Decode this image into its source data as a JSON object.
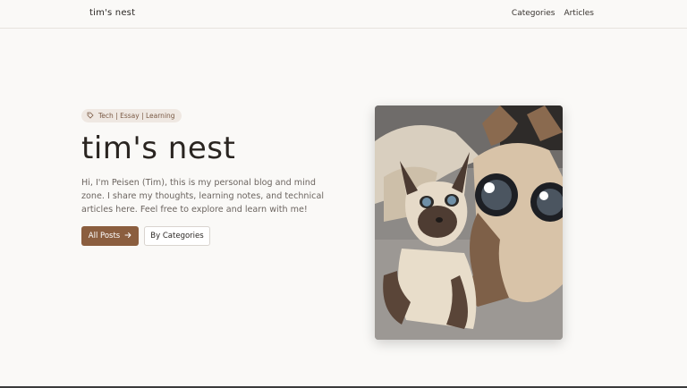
{
  "header": {
    "site_title": "tim's nest",
    "nav": [
      "Categories",
      "Articles"
    ]
  },
  "hero": {
    "tag_icon": "tag-icon",
    "tags_text": "Tech | Essay | Learning",
    "title": "tim's nest",
    "description": "Hi, I'm Peisen (Tim), this is my personal blog and mind zone. I share my thoughts, learning notes, and technical articles here. Feel free to explore and learn with me!",
    "primary_button": "All Posts",
    "primary_button_icon": "arrow-right-icon",
    "secondary_button": "By Categories"
  },
  "colors": {
    "background": "#faf9f7",
    "accent": "#8b5e3f",
    "tag_bg": "#efe8e2",
    "tag_text": "#7a5a45"
  }
}
